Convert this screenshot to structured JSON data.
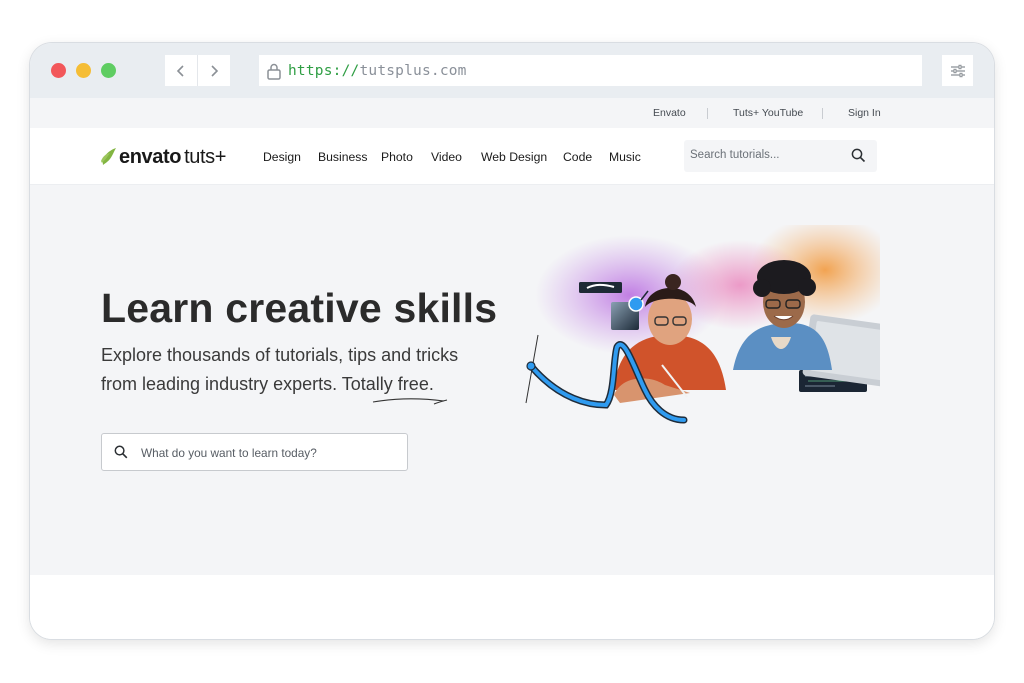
{
  "browser": {
    "url_scheme": "https://",
    "url_host": "tutsplus.com",
    "back_icon": "chevron-left-icon",
    "forward_icon": "chevron-right-icon",
    "lock_icon": "lock-icon",
    "settings_icon": "sliders-icon"
  },
  "topbar": {
    "links": [
      "Envato",
      "Tuts+ YouTube",
      "Sign In"
    ]
  },
  "header": {
    "logo_brand": "envato",
    "logo_product": "tuts+",
    "nav": [
      "Design",
      "Business",
      "Photo",
      "Video",
      "Web Design",
      "Code",
      "Music"
    ],
    "search_placeholder": "Search tutorials...",
    "search_icon": "search-icon"
  },
  "hero": {
    "title": "Learn creative skills",
    "subtitle_line1": "Explore thousands of tutorials, tips and tricks",
    "subtitle_line2": "from leading industry experts. Totally free.",
    "search_placeholder": "What do you want to learn today?"
  },
  "colors": {
    "brand_green": "#82b541",
    "url_scheme_green": "#2f9e44",
    "hero_background": "#f4f5f7",
    "accent_blue": "#2f9bf0"
  }
}
